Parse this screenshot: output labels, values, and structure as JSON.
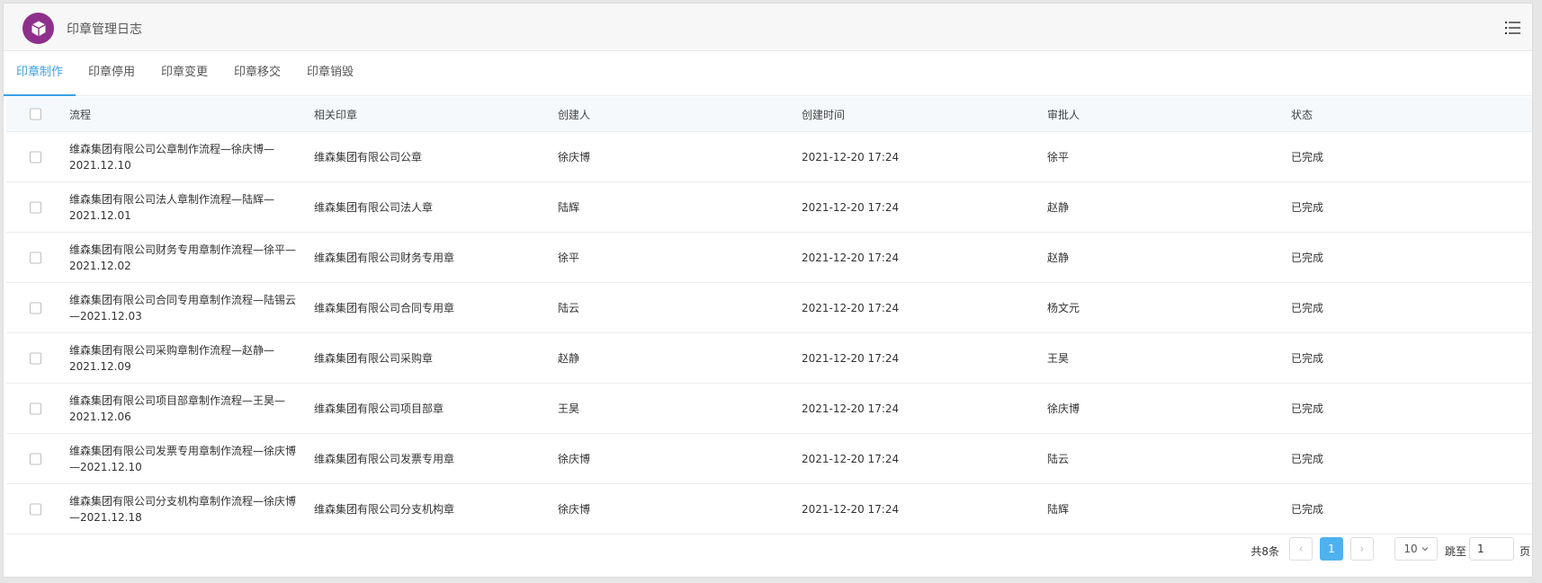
{
  "app": {
    "title": "印章管理日志"
  },
  "tabs": [
    {
      "label": "印章制作",
      "active": true
    },
    {
      "label": "印章停用",
      "active": false
    },
    {
      "label": "印章变更",
      "active": false
    },
    {
      "label": "印章移交",
      "active": false
    },
    {
      "label": "印章销毁",
      "active": false
    }
  ],
  "table": {
    "headers": {
      "flow": "流程",
      "seal": "相关印章",
      "creator": "创建人",
      "time": "创建时间",
      "approver": "审批人",
      "status": "状态"
    },
    "rows": [
      {
        "flow1": "维森集团有限公司公章制作流程—徐庆博—",
        "flow2": "2021.12.10",
        "seal": "维森集团有限公司公章",
        "creator": "徐庆博",
        "time": "2021-12-20 17:24",
        "approver": "徐平",
        "status": "已完成"
      },
      {
        "flow1": "维森集团有限公司法人章制作流程—陆辉—",
        "flow2": "2021.12.01",
        "seal": "维森集团有限公司法人章",
        "creator": "陆辉",
        "time": "2021-12-20 17:24",
        "approver": "赵静",
        "status": "已完成"
      },
      {
        "flow1": "维森集团有限公司财务专用章制作流程—徐平—",
        "flow2": "2021.12.02",
        "seal": "维森集团有限公司财务专用章",
        "creator": "徐平",
        "time": "2021-12-20 17:24",
        "approver": "赵静",
        "status": "已完成"
      },
      {
        "flow1": "维森集团有限公司合同专用章制作流程—陆锡云",
        "flow2": "—2021.12.03",
        "seal": "维森集团有限公司合同专用章",
        "creator": "陆云",
        "time": "2021-12-20 17:24",
        "approver": "杨文元",
        "status": "已完成"
      },
      {
        "flow1": "维森集团有限公司采购章制作流程—赵静—",
        "flow2": "2021.12.09",
        "seal": "维森集团有限公司采购章",
        "creator": "赵静",
        "time": "2021-12-20 17:24",
        "approver": "王昊",
        "status": "已完成"
      },
      {
        "flow1": "维森集团有限公司项目部章制作流程—王昊—",
        "flow2": "2021.12.06",
        "seal": "维森集团有限公司项目部章",
        "creator": "王昊",
        "time": "2021-12-20 17:24",
        "approver": "徐庆博",
        "status": "已完成"
      },
      {
        "flow1": "维森集团有限公司发票专用章制作流程—徐庆博",
        "flow2": "—2021.12.10",
        "seal": "维森集团有限公司发票专用章",
        "creator": "徐庆博",
        "time": "2021-12-20 17:24",
        "approver": "陆云",
        "status": "已完成"
      },
      {
        "flow1": "维森集团有限公司分支机构章制作流程—徐庆博",
        "flow2": "—2021.12.18",
        "seal": "维森集团有限公司分支机构章",
        "creator": "徐庆博",
        "time": "2021-12-20 17:24",
        "approver": "陆辉",
        "status": "已完成"
      }
    ]
  },
  "pagination": {
    "total": "共8条",
    "prev": "‹",
    "page": "1",
    "next": "›",
    "page_size": "10",
    "page_size_icon": "chevron-down-icon",
    "jump_label": "跳至",
    "jump_value": "1",
    "unit": "页"
  },
  "colors": {
    "accent": "#3aa0e8",
    "logo": "#8e2f8c",
    "page_active": "#4fb2ee"
  },
  "icons": {
    "logo": "box-icon",
    "menu": "list-menu-icon",
    "checkbox": "checkbox-icon"
  }
}
